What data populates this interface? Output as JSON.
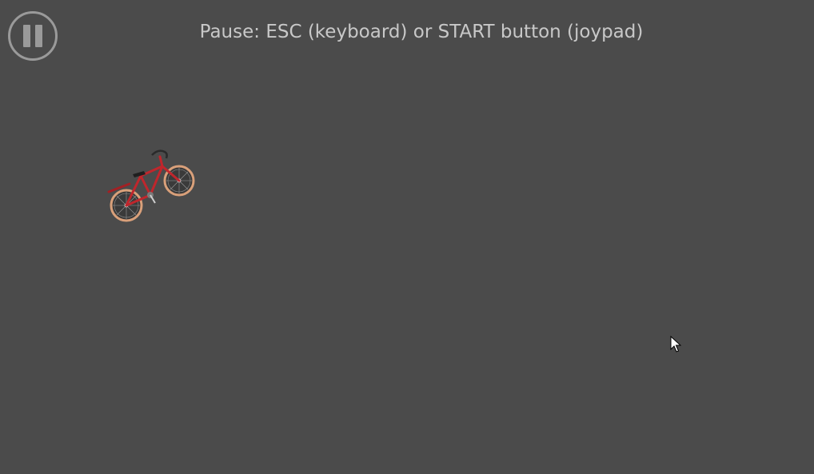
{
  "hud": {
    "pause_hint": "Pause: ESC (keyboard) or START button (joypad)",
    "pause_icon": "pause-icon"
  },
  "scene": {
    "background_color": "#4b4b4b",
    "sprite": "bicycle-sprite",
    "bike_color": "#c0262c",
    "tire_color": "#d9a07a"
  },
  "pointer": {
    "icon": "mouse-cursor-icon"
  }
}
